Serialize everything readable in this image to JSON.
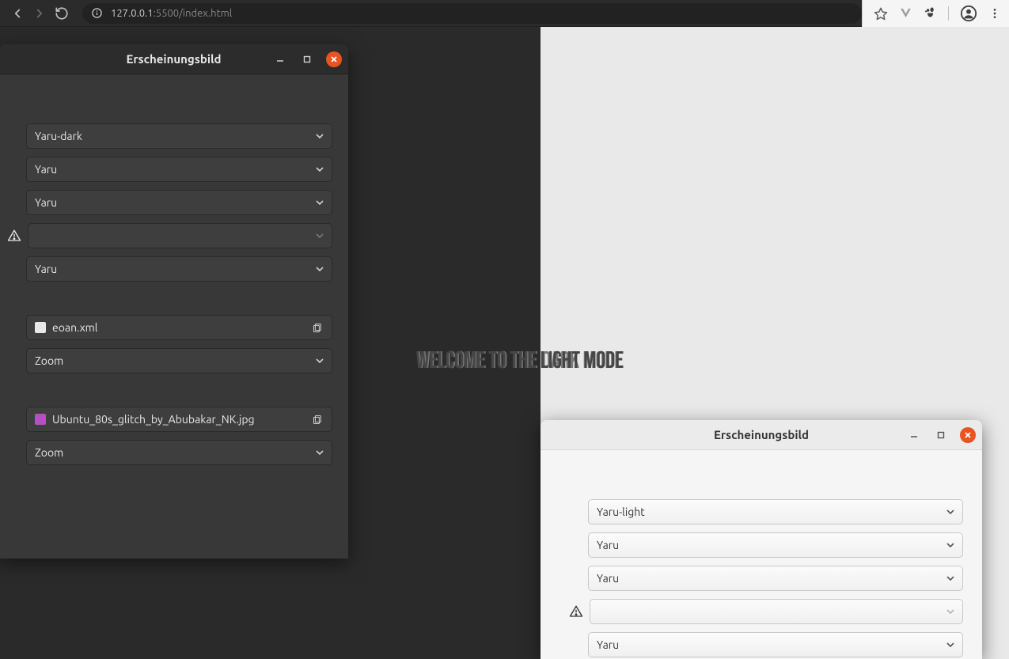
{
  "browser": {
    "url_host": "127.0.0.1",
    "url_port_path": ":5500/index.html"
  },
  "page": {
    "dark_title": "Welcome to the dark mode",
    "light_title": "Welcome to the light mode"
  },
  "dark_window": {
    "title": "Erscheinungsbild",
    "combos": {
      "c0": "Yaru-dark",
      "c1": "Yaru",
      "c2": "Yaru",
      "c3": "",
      "c4": "Yaru"
    },
    "file1": "eoan.xml",
    "file1_mode": "Zoom",
    "file2": "Ubuntu_80s_glitch_by_Abubakar_NK.jpg",
    "file2_mode": "Zoom"
  },
  "light_window": {
    "title": "Erscheinungsbild",
    "combos": {
      "c0": "Yaru-light",
      "c1": "Yaru",
      "c2": "Yaru",
      "c3": "",
      "c4": "Yaru"
    }
  }
}
